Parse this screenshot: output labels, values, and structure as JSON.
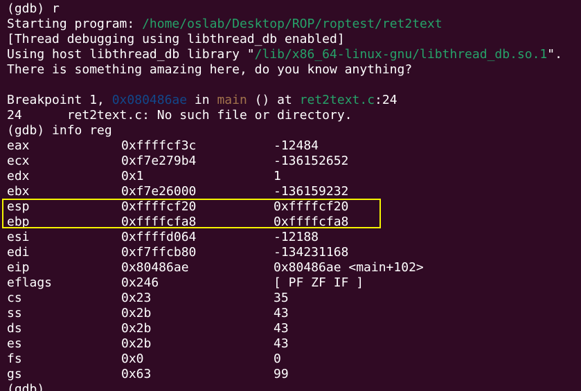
{
  "terminal": {
    "colors": {
      "background": "#300a24",
      "text": "#ffffff",
      "path": "#26a269",
      "address": "#12488b",
      "function": "#a2734c",
      "highlight_box": "#f5f500"
    },
    "lines": {
      "cmd_run": "(gdb) r",
      "start_prefix": "Starting program: ",
      "start_path": "/home/oslab/Desktop/ROP/roptest/ret2text",
      "thread_debug": "[Thread debugging using libthread_db enabled]",
      "host_prefix": "Using host libthread_db library \"",
      "host_path": "/lib/x86_64-linux-gnu/libthread_db.so.1",
      "host_suffix": "\".",
      "amazing": "There is something amazing here, do you know anything?",
      "bp_prefix": "Breakpoint 1, ",
      "bp_addr": "0x080486ae",
      "bp_in": " in ",
      "bp_func": "main",
      "bp_at": " () at ",
      "bp_file": "ret2text.c",
      "bp_line": ":24",
      "src_line": "24      ret2text.c: No such file or directory.",
      "cmd_info": "(gdb) info reg",
      "cmd_prompt_partial": "(gdb)"
    },
    "registers": [
      {
        "name": "eax",
        "hex": "0xffffcf3c",
        "value": "-12484"
      },
      {
        "name": "ecx",
        "hex": "0xf7e279b4",
        "value": "-136152652"
      },
      {
        "name": "edx",
        "hex": "0x1",
        "value": "1"
      },
      {
        "name": "ebx",
        "hex": "0xf7e26000",
        "value": "-136159232"
      },
      {
        "name": "esp",
        "hex": "0xffffcf20",
        "value": "0xffffcf20"
      },
      {
        "name": "ebp",
        "hex": "0xffffcfa8",
        "value": "0xffffcfa8"
      },
      {
        "name": "esi",
        "hex": "0xffffd064",
        "value": "-12188"
      },
      {
        "name": "edi",
        "hex": "0xf7ffcb80",
        "value": "-134231168"
      },
      {
        "name": "eip",
        "hex": "0x80486ae",
        "value": "0x80486ae <main+102>"
      },
      {
        "name": "eflags",
        "hex": "0x246",
        "value": "[ PF ZF IF ]"
      },
      {
        "name": "cs",
        "hex": "0x23",
        "value": "35"
      },
      {
        "name": "ss",
        "hex": "0x2b",
        "value": "43"
      },
      {
        "name": "ds",
        "hex": "0x2b",
        "value": "43"
      },
      {
        "name": "es",
        "hex": "0x2b",
        "value": "43"
      },
      {
        "name": "fs",
        "hex": "0x0",
        "value": "0"
      },
      {
        "name": "gs",
        "hex": "0x63",
        "value": "99"
      }
    ]
  }
}
